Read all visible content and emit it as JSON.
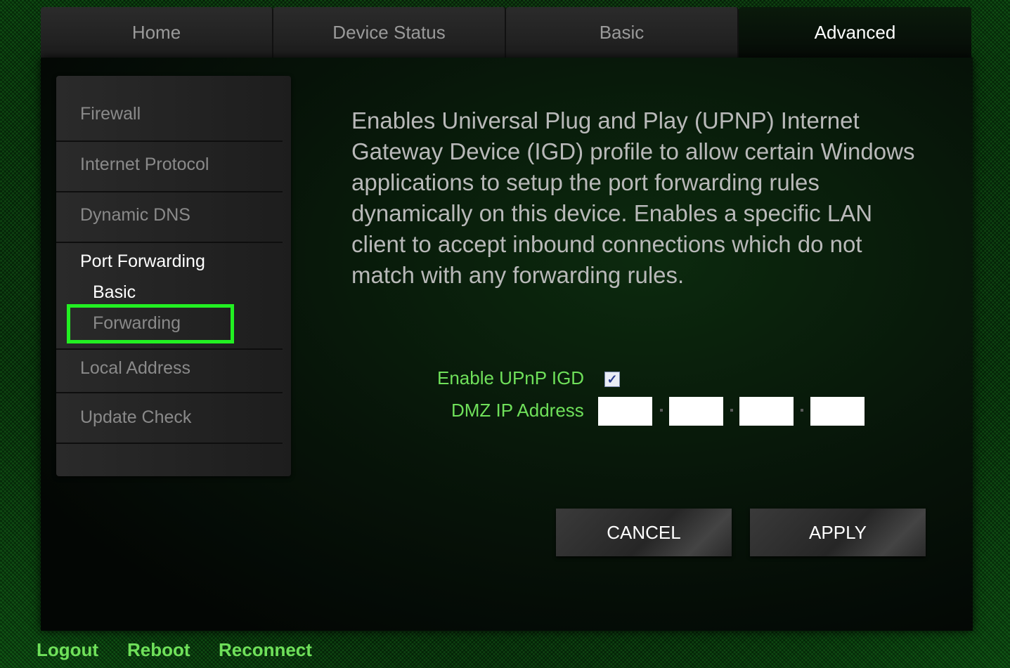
{
  "tabs": [
    "Home",
    "Device Status",
    "Basic",
    "Advanced"
  ],
  "active_tab": "Advanced",
  "sidebar": {
    "items": [
      "Firewall",
      "Internet Protocol",
      "Dynamic DNS",
      "Port Forwarding",
      "Local Address",
      "Update Check"
    ],
    "sub_items": [
      "Basic",
      "Forwarding"
    ],
    "active_item": "Port Forwarding",
    "selected_sub_item": "Forwarding"
  },
  "description": "Enables Universal Plug and Play (UPNP) Internet Gateway Device (IGD) profile to allow certain Windows applications to setup the port forwarding rules dynamically on this device. Enables a specific LAN client to accept inbound connections which do not match with any forwarding rules.",
  "form": {
    "upnp_label": "Enable UPnP IGD",
    "upnp_checked": true,
    "dmz_label": "DMZ IP Address",
    "dmz_octets": [
      "",
      "",
      "",
      ""
    ]
  },
  "buttons": {
    "cancel": "CANCEL",
    "apply": "APPLY"
  },
  "footer": {
    "logout": "Logout",
    "reboot": "Reboot",
    "reconnect": "Reconnect"
  },
  "colors": {
    "accent_green": "#6fe05a",
    "highlight_green": "#22f022"
  }
}
